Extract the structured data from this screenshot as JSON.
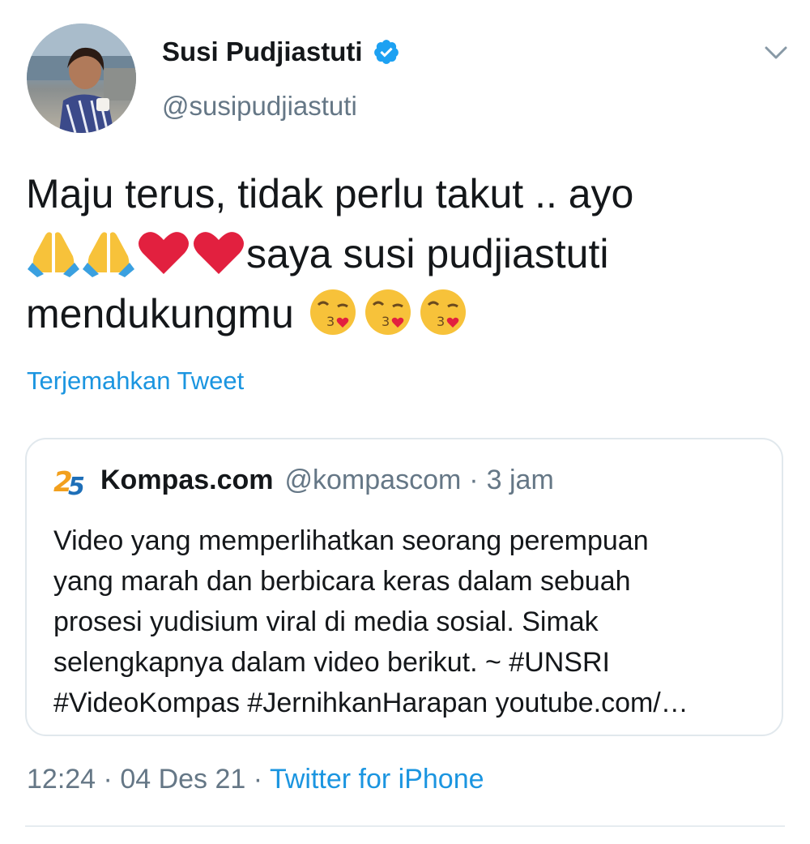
{
  "author": {
    "display_name": "Susi Pudjiastuti",
    "handle": "@susipudjiastuti",
    "verified": true,
    "avatar_icon": "profile-photo"
  },
  "tweet": {
    "line1": "Maju terus, tidak perlu takut .. ayo",
    "line2_text": "saya susi pudjiastuti",
    "line3_text": "mendukungmu",
    "emojis": [
      "folded-hands",
      "folded-hands",
      "red-heart",
      "red-heart",
      "face-blowing-kiss",
      "face-blowing-kiss",
      "face-blowing-kiss"
    ],
    "translate_label": "Terjemahkan Tweet"
  },
  "quoted": {
    "name": "Kompas.com",
    "handle": "@kompascom",
    "separator": "·",
    "time": "3 jam",
    "logo_icon": "kompas-logo",
    "lines": [
      "Video yang memperlihatkan seorang perempuan",
      "yang marah dan berbicara keras dalam sebuah",
      "prosesi yudisium viral di media sosial. Simak",
      "selengkapnya dalam video berikut. ~ #UNSRI",
      "#VideoKompas #JernihkanHarapan youtube.com/…"
    ]
  },
  "meta": {
    "time": "12:24",
    "sep1": "·",
    "date": "04 Des 21",
    "sep2": "·",
    "source": "Twitter for iPhone"
  },
  "colors": {
    "link": "#1b95e0",
    "secondary": "#657786",
    "verified": "#1da1f2",
    "border": "#e1e8ed"
  }
}
